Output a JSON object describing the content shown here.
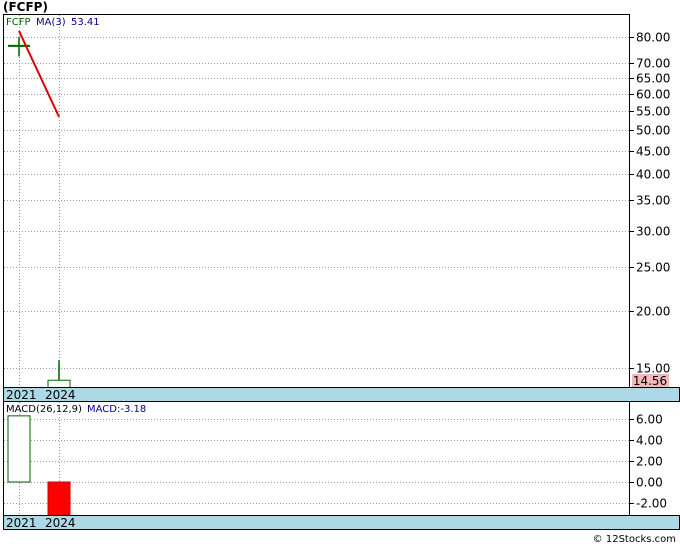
{
  "title": "(FCFP)",
  "credit": "© 12Stocks.com",
  "chart_data": [
    {
      "type": "candlestick",
      "ticker_label": "FCFP",
      "ma_label": "MA(3)",
      "ma_value": "53.41",
      "last_price_label": "14.56",
      "x_tick_labels": [
        "2021",
        "2024"
      ],
      "y_tick_labels": [
        "80.00",
        "70.00",
        "65.00",
        "60.00",
        "55.00",
        "50.00",
        "45.00",
        "40.00",
        "35.00",
        "30.00",
        "25.00",
        "20.00",
        "15.00"
      ],
      "y_ticks": [
        80,
        70,
        65,
        60,
        55,
        50,
        45,
        40,
        35,
        30,
        25,
        20,
        15
      ],
      "y_scale": "log",
      "candles": [
        {
          "x": "2021",
          "open": 76.5,
          "close": 76.5,
          "high": 80,
          "low": 72.5,
          "color": "#006400"
        },
        {
          "x": "2024",
          "open": 13.2,
          "close": 14.1,
          "high": 15.6,
          "low": 12.6,
          "color": "#006400"
        }
      ],
      "ma_line": [
        {
          "x": "2021",
          "y": 82.5
        },
        {
          "x": "2024",
          "y": 53.41
        }
      ],
      "ma_color": "#dd0000",
      "grid": true
    },
    {
      "type": "bar",
      "label": "MACD(26,12,9)",
      "value_label": "MACD:-3.18",
      "categories": [
        "2021",
        "2024"
      ],
      "values": [
        6.3,
        -3.18
      ],
      "bar_colors": [
        "#ffffff",
        "#ff0000"
      ],
      "y_ticks": [
        6,
        4,
        2,
        0,
        -2
      ],
      "y_tick_labels": [
        "6.00",
        "4.00",
        "2.00",
        "0.00",
        "-2.00"
      ],
      "ylim": [
        -3.3,
        7.4
      ],
      "grid": true
    }
  ]
}
